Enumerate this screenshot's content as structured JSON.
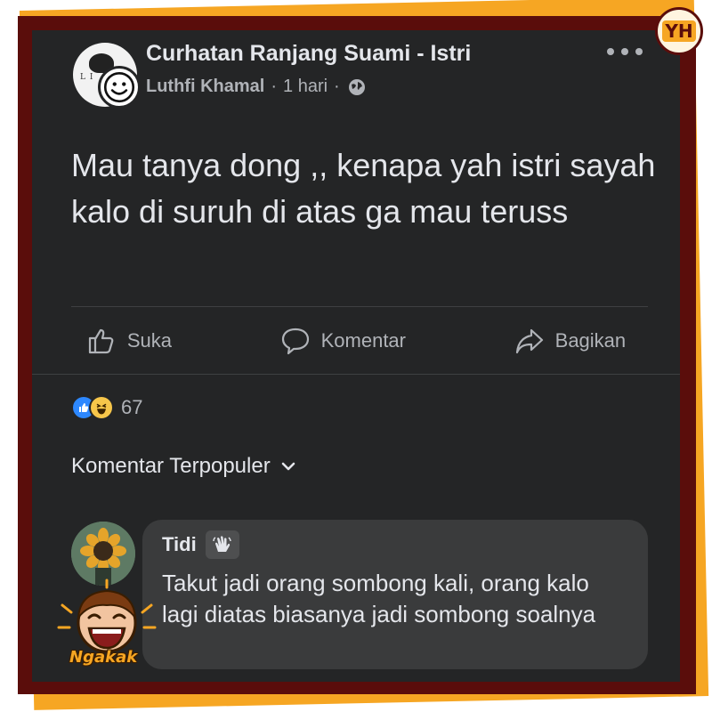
{
  "post": {
    "group_name": "Curhatan Ranjang Suami - Istri",
    "author": "Luthfi Khamal",
    "time": "1 hari",
    "separator": "·",
    "text": "Mau tanya dong ,, kenapa yah istri sayah kalo di suruh di atas ga mau teruss"
  },
  "actions": {
    "like_label": "Suka",
    "comment_label": "Komentar",
    "share_label": "Bagikan"
  },
  "reactions": {
    "count": "67"
  },
  "comments": {
    "sort_label": "Komentar Terpopuler",
    "items": [
      {
        "name": "Tidi",
        "text": "Takut jadi orang sombong kali, orang kalo lagi diatas biasanya jadi sombong soalnya"
      }
    ]
  },
  "overlay": {
    "logo_text": "YH",
    "sticker_text": "Ngakak"
  },
  "colors": {
    "card_bg": "#242526",
    "bubble_bg": "#3a3b3c",
    "like_blue": "#2d88ff",
    "haha_yellow": "#f7c64a",
    "frame_maroon": "#5a0d0b",
    "frame_orange": "#f6a623"
  }
}
